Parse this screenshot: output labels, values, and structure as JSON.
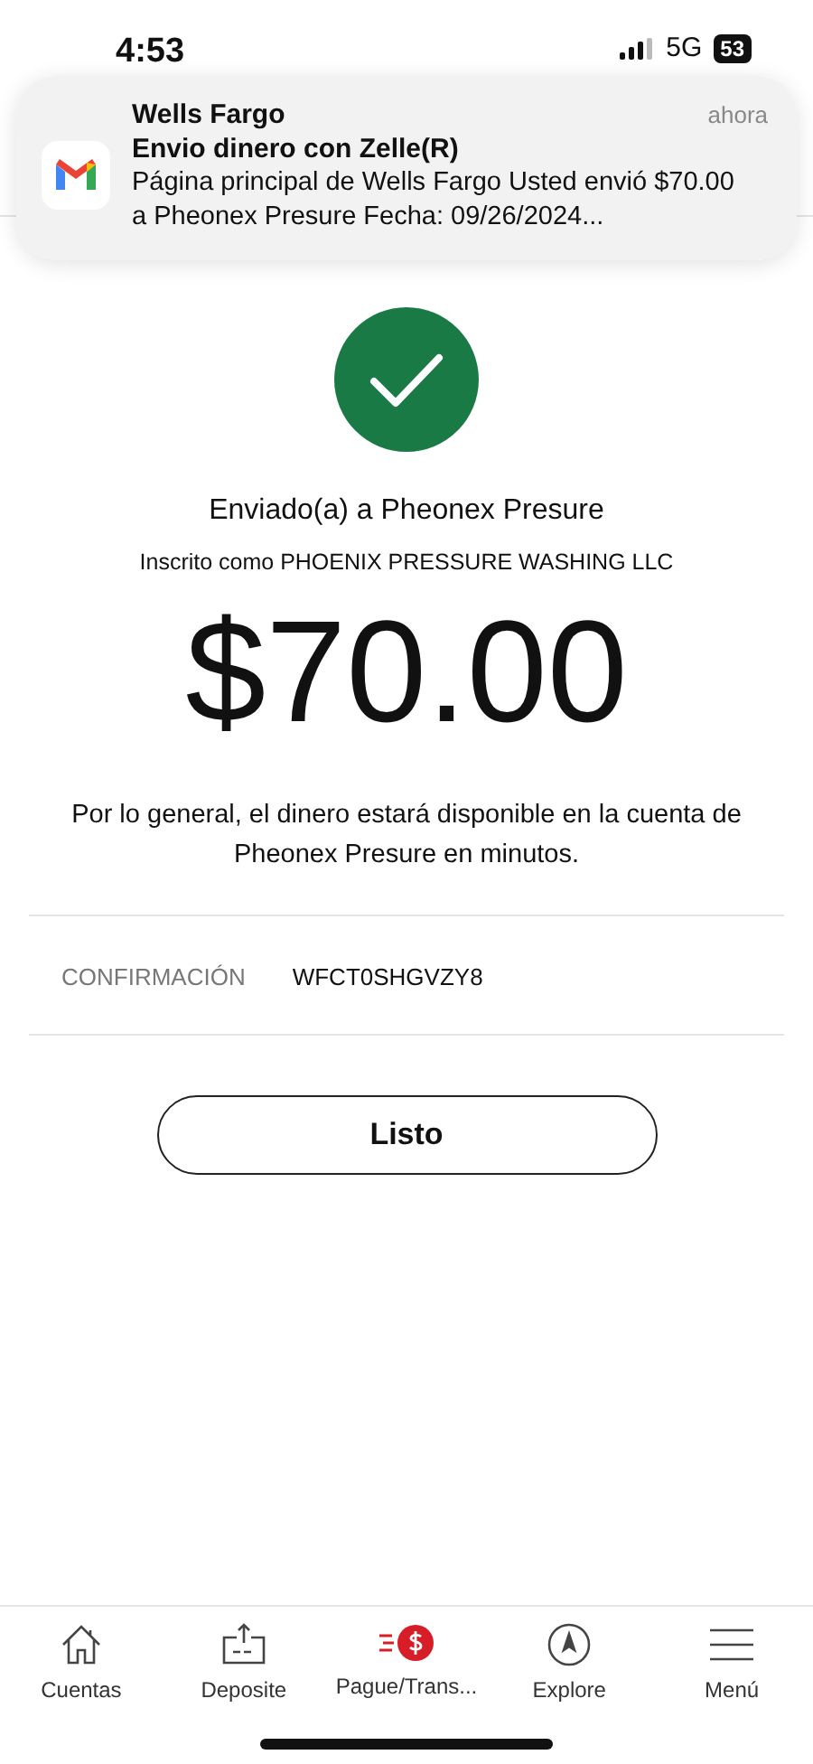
{
  "status_bar": {
    "time": "4:53",
    "network": "5G",
    "battery": "53"
  },
  "notification": {
    "app": "Wells Fargo",
    "time": "ahora",
    "subject": "Envio dinero con Zelle(R)",
    "body": "Página principal de Wells Fargo Usted envió $70.00 a Pheonex Presure Fecha: 09/26/2024..."
  },
  "recipient": "Enviado(a) a Pheonex Presure",
  "enrolled_as": "Inscrito como PHOENIX PRESSURE WASHING LLC",
  "amount": "$70.00",
  "note": "Por lo general, el dinero estará disponible en la cuenta de Pheonex Presure en minutos.",
  "confirmation": {
    "label": "CONFIRMACIÓN",
    "value": "WFCT0SHGVZY8"
  },
  "done_button": "Listo",
  "nav": [
    {
      "kind": "home",
      "label": "Cuentas",
      "selected": false
    },
    {
      "kind": "deposit",
      "label": "Deposite",
      "selected": false
    },
    {
      "kind": "pay",
      "label": "Pague/Trans...",
      "selected": true
    },
    {
      "kind": "explore",
      "label": "Explore",
      "selected": false
    },
    {
      "kind": "menu",
      "label": "Menú",
      "selected": false
    }
  ]
}
